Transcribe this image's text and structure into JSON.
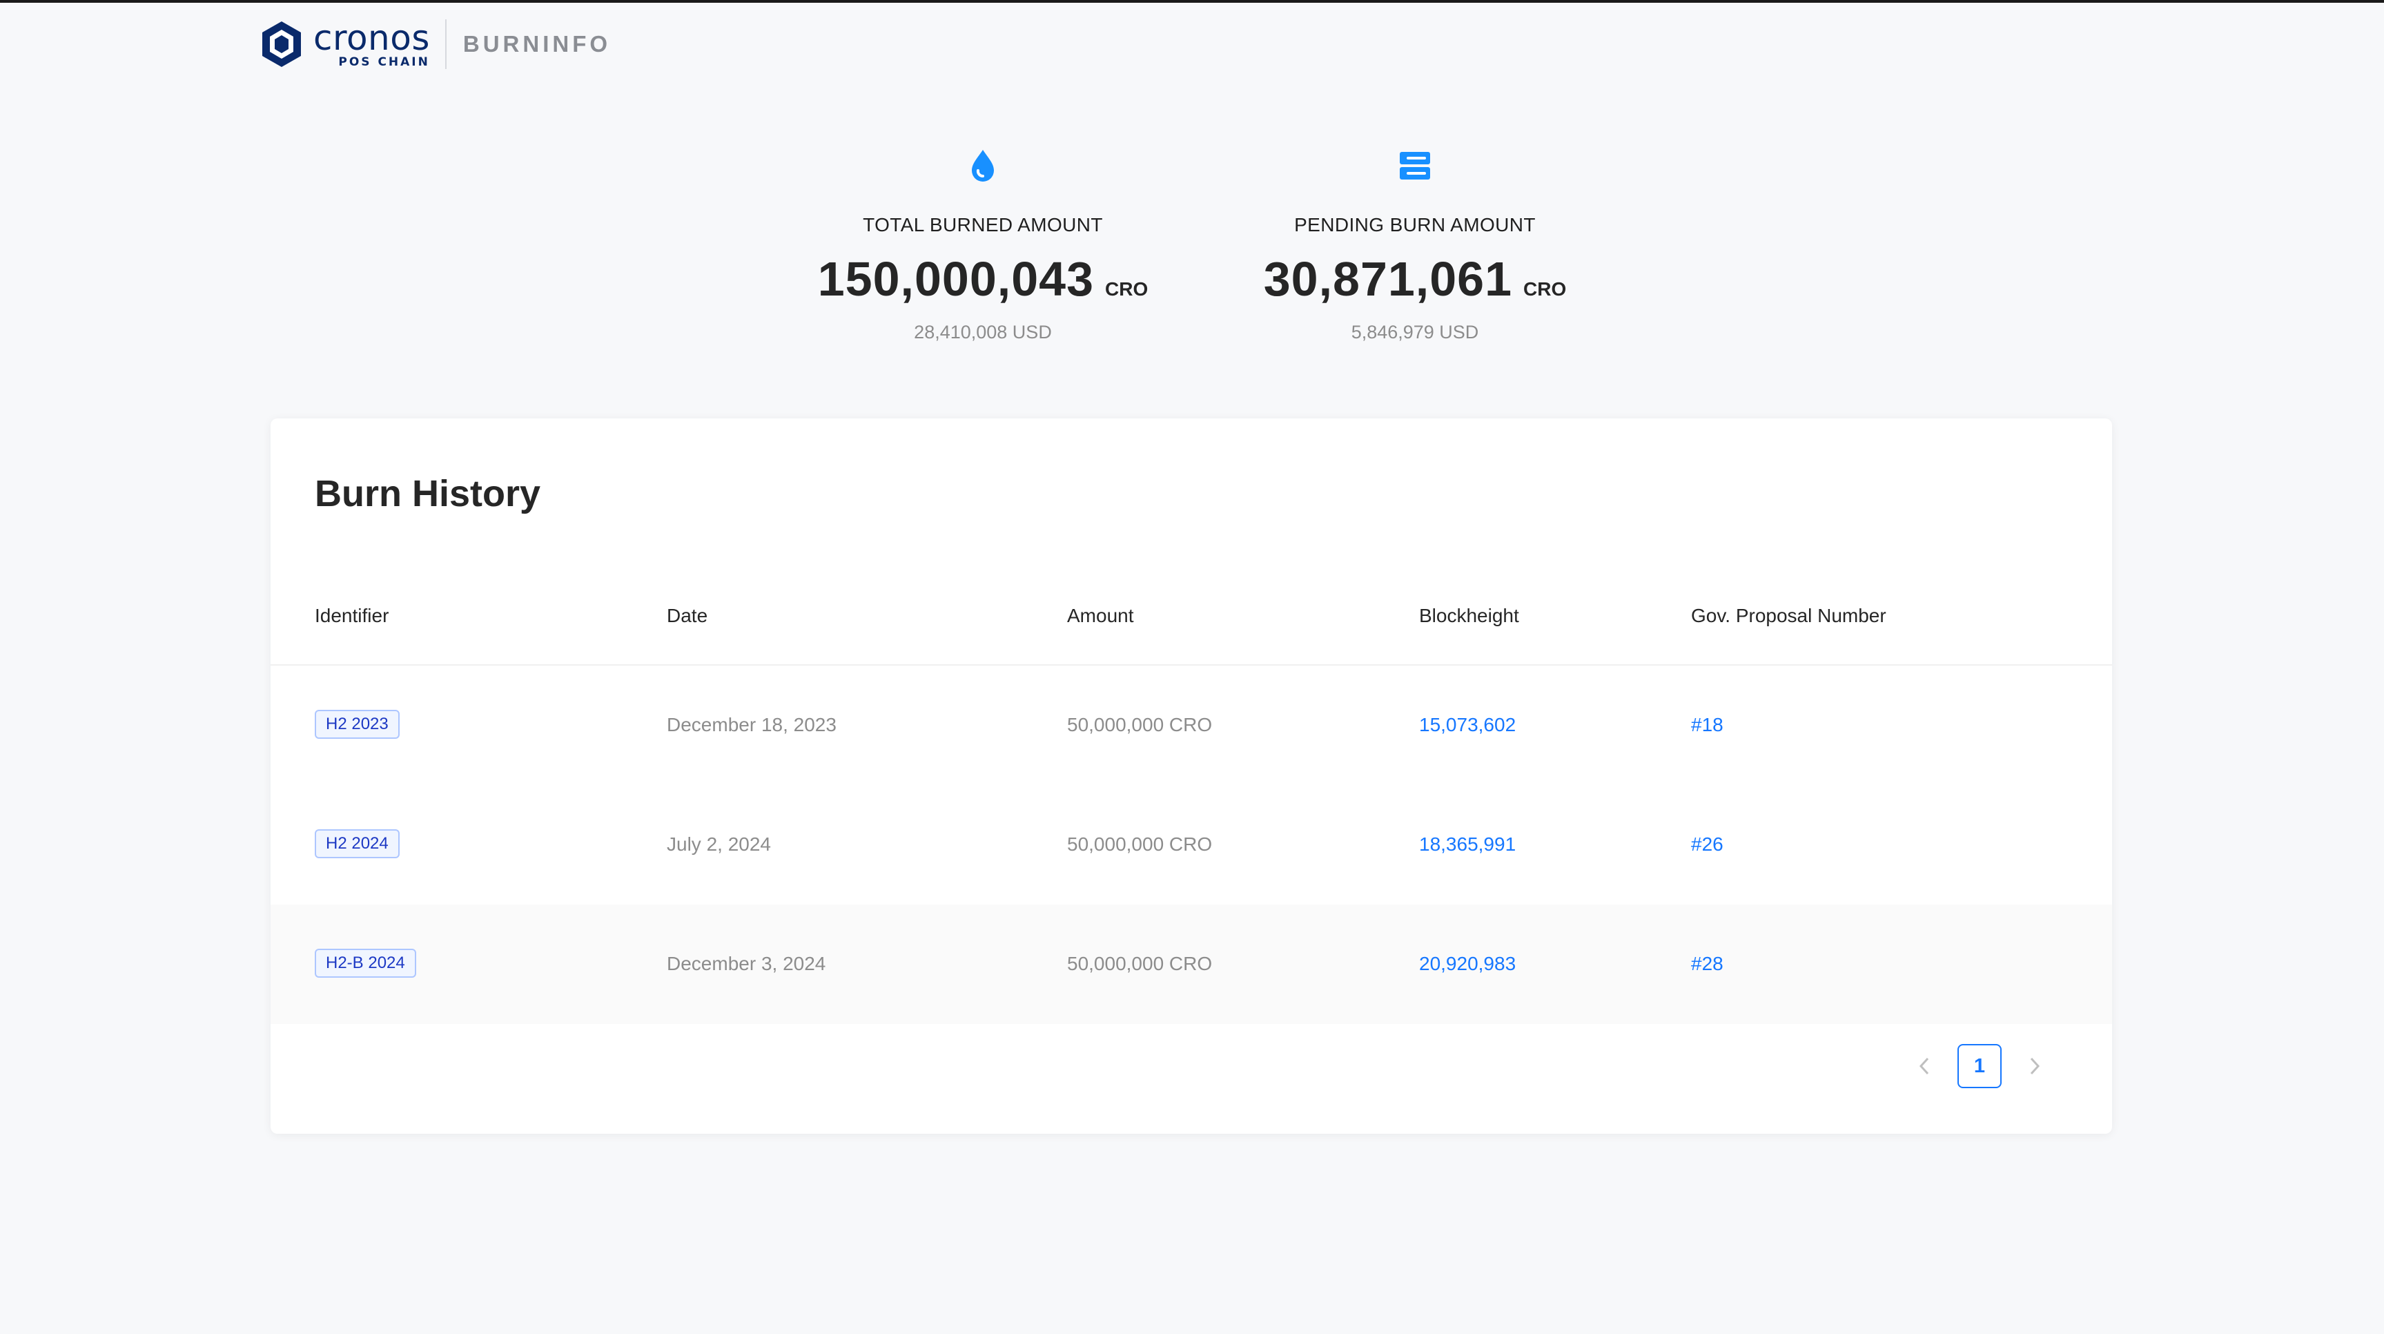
{
  "brand": {
    "logo_word": "cronos",
    "logo_sub": "POS CHAIN",
    "product": "BURNINFO"
  },
  "stats": {
    "total": {
      "icon": "drop-icon",
      "label": "TOTAL BURNED AMOUNT",
      "value": "150,000,043",
      "unit": "CRO",
      "usd": "28,410,008 USD"
    },
    "pending": {
      "icon": "server-icon",
      "label": "PENDING BURN AMOUNT",
      "value": "30,871,061",
      "unit": "CRO",
      "usd": "5,846,979 USD"
    }
  },
  "history": {
    "title": "Burn History",
    "columns": [
      "Identifier",
      "Date",
      "Amount",
      "Blockheight",
      "Gov. Proposal Number"
    ],
    "rows": [
      {
        "identifier": "H2 2023",
        "date": "December 18, 2023",
        "amount": "50,000,000 CRO",
        "blockheight": "15,073,602",
        "proposal": "#18"
      },
      {
        "identifier": "H2 2024",
        "date": "July 2, 2024",
        "amount": "50,000,000 CRO",
        "blockheight": "18,365,991",
        "proposal": "#26"
      },
      {
        "identifier": "H2-B 2024",
        "date": "December 3, 2024",
        "amount": "50,000,000 CRO",
        "blockheight": "20,920,983",
        "proposal": "#28"
      }
    ]
  },
  "pagination": {
    "current": "1",
    "prev_icon": "chevron-left-icon",
    "next_icon": "chevron-right-icon"
  },
  "colors": {
    "accent": "#1677ff",
    "brand": "#0a2a6b",
    "tag_border": "#adc6ff",
    "tag_bg": "#f0f5ff",
    "tag_text": "#1d39c4"
  }
}
